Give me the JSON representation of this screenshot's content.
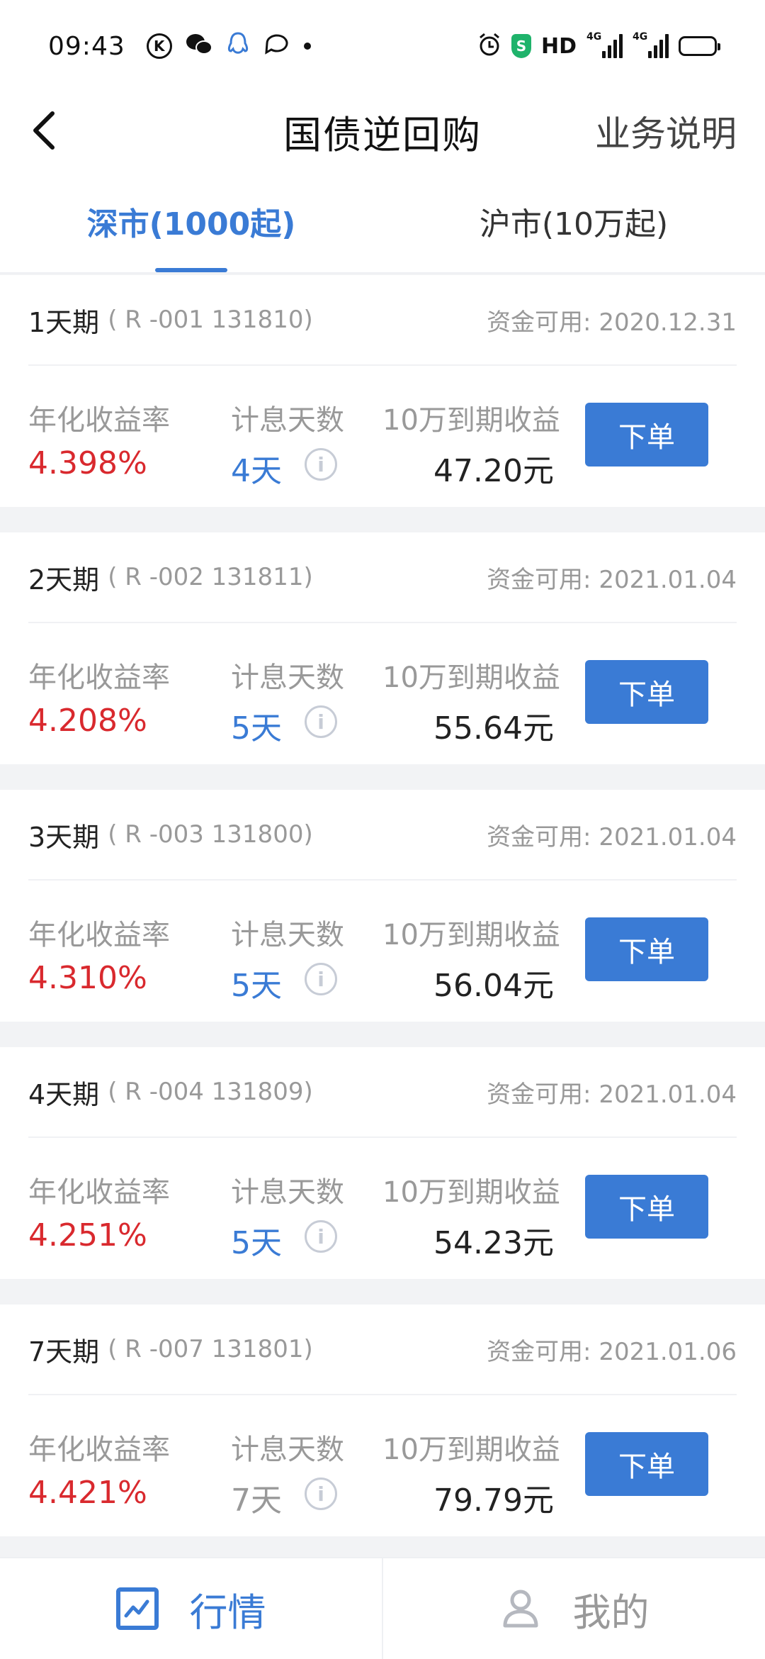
{
  "status_bar": {
    "time": "09:43",
    "k_icon": "K",
    "shield_icon": "S",
    "hd": "HD",
    "network1": "4G",
    "network2": "4G"
  },
  "header": {
    "title": "国债逆回购",
    "help_label": "业务说明"
  },
  "tabs": [
    {
      "label": "深市(1000起)",
      "active": true
    },
    {
      "label": "沪市(10万起)",
      "active": false
    }
  ],
  "labels": {
    "rate": "年化收益率",
    "days": "计息天数",
    "income": "10万到期收益",
    "order": "下单",
    "info": "i"
  },
  "items": [
    {
      "term": "1天期",
      "code": "( R -001 131810)",
      "available": "资金可用: 2020.12.31",
      "rate": "4.398%",
      "days": "4天",
      "income": "47.20元"
    },
    {
      "term": "2天期",
      "code": "( R -002 131811)",
      "available": "资金可用: 2021.01.04",
      "rate": "4.208%",
      "days": "5天",
      "income": "55.64元"
    },
    {
      "term": "3天期",
      "code": "( R -003 131800)",
      "available": "资金可用: 2021.01.04",
      "rate": "4.310%",
      "days": "5天",
      "income": "56.04元"
    },
    {
      "term": "4天期",
      "code": "( R -004 131809)",
      "available": "资金可用: 2021.01.04",
      "rate": "4.251%",
      "days": "5天",
      "income": "54.23元"
    },
    {
      "term": "7天期",
      "code": "( R -007 131801)",
      "available": "资金可用: 2021.01.06",
      "rate": "4.421%",
      "days": "7天",
      "income": "79.79元"
    }
  ],
  "bottom_nav": [
    {
      "label": "行情",
      "icon": "chart-icon",
      "active": true
    },
    {
      "label": "我的",
      "icon": "user-icon",
      "active": false
    }
  ],
  "colors": {
    "accent": "#3a7bd5",
    "rate": "#d9292e",
    "muted": "#999999"
  }
}
